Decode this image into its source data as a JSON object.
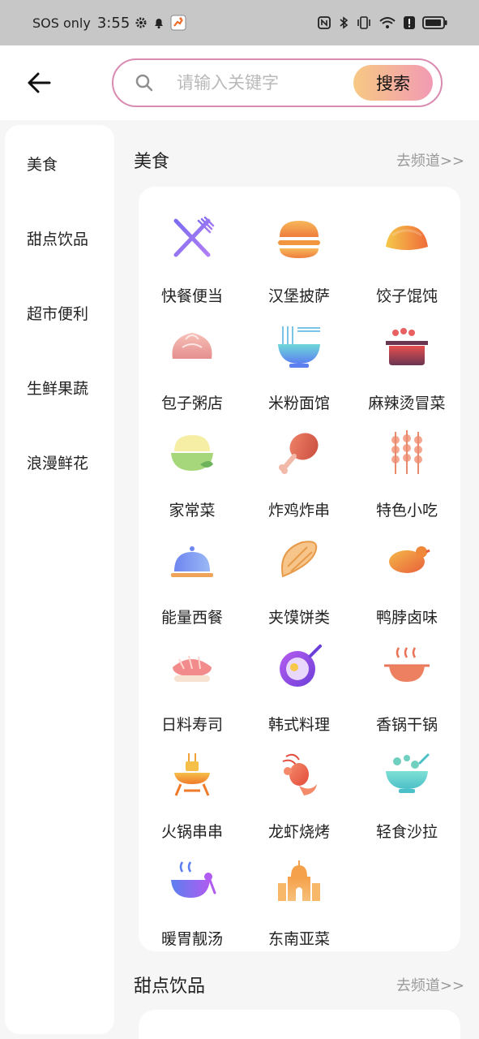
{
  "status_bar": {
    "carrier": "SOS only",
    "time": "3:55",
    "battery_icon": "battery-icon"
  },
  "search": {
    "placeholder": "请输入关键字",
    "button": "搜索"
  },
  "sidebar": {
    "items": [
      "美食",
      "甜点饮品",
      "超市便利",
      "生鲜果蔬",
      "浪漫鲜花"
    ]
  },
  "sections": [
    {
      "title": "美食",
      "link": "去频道>>"
    },
    {
      "title": "甜点饮品",
      "link": "去频道>>"
    }
  ],
  "categories": [
    {
      "label": "快餐便当",
      "icon": "fork-knife-icon"
    },
    {
      "label": "汉堡披萨",
      "icon": "burger-icon"
    },
    {
      "label": "饺子馄饨",
      "icon": "dumpling-icon"
    },
    {
      "label": "包子粥店",
      "icon": "bun-icon"
    },
    {
      "label": "米粉面馆",
      "icon": "noodle-bowl-icon"
    },
    {
      "label": "麻辣烫冒菜",
      "icon": "hotpot-skewer-icon"
    },
    {
      "label": "家常菜",
      "icon": "rice-bowl-icon"
    },
    {
      "label": "炸鸡炸串",
      "icon": "drumstick-icon"
    },
    {
      "label": "特色小吃",
      "icon": "skewers-icon"
    },
    {
      "label": "能量西餐",
      "icon": "cloche-icon"
    },
    {
      "label": "夹馍饼类",
      "icon": "taco-icon"
    },
    {
      "label": "鸭脖卤味",
      "icon": "roast-duck-icon"
    },
    {
      "label": "日料寿司",
      "icon": "sushi-icon"
    },
    {
      "label": "韩式料理",
      "icon": "frying-pan-icon"
    },
    {
      "label": "香锅干锅",
      "icon": "dry-pot-icon"
    },
    {
      "label": "火锅串串",
      "icon": "grill-icon"
    },
    {
      "label": "龙虾烧烤",
      "icon": "lobster-icon"
    },
    {
      "label": "轻食沙拉",
      "icon": "salad-icon"
    },
    {
      "label": "暖胃靓汤",
      "icon": "soup-icon"
    },
    {
      "label": "东南亚菜",
      "icon": "temple-icon"
    }
  ],
  "colors": {
    "search_border": "#d98bb0",
    "search_button_start": "#f7c983",
    "search_button_end": "#f29ab4"
  }
}
